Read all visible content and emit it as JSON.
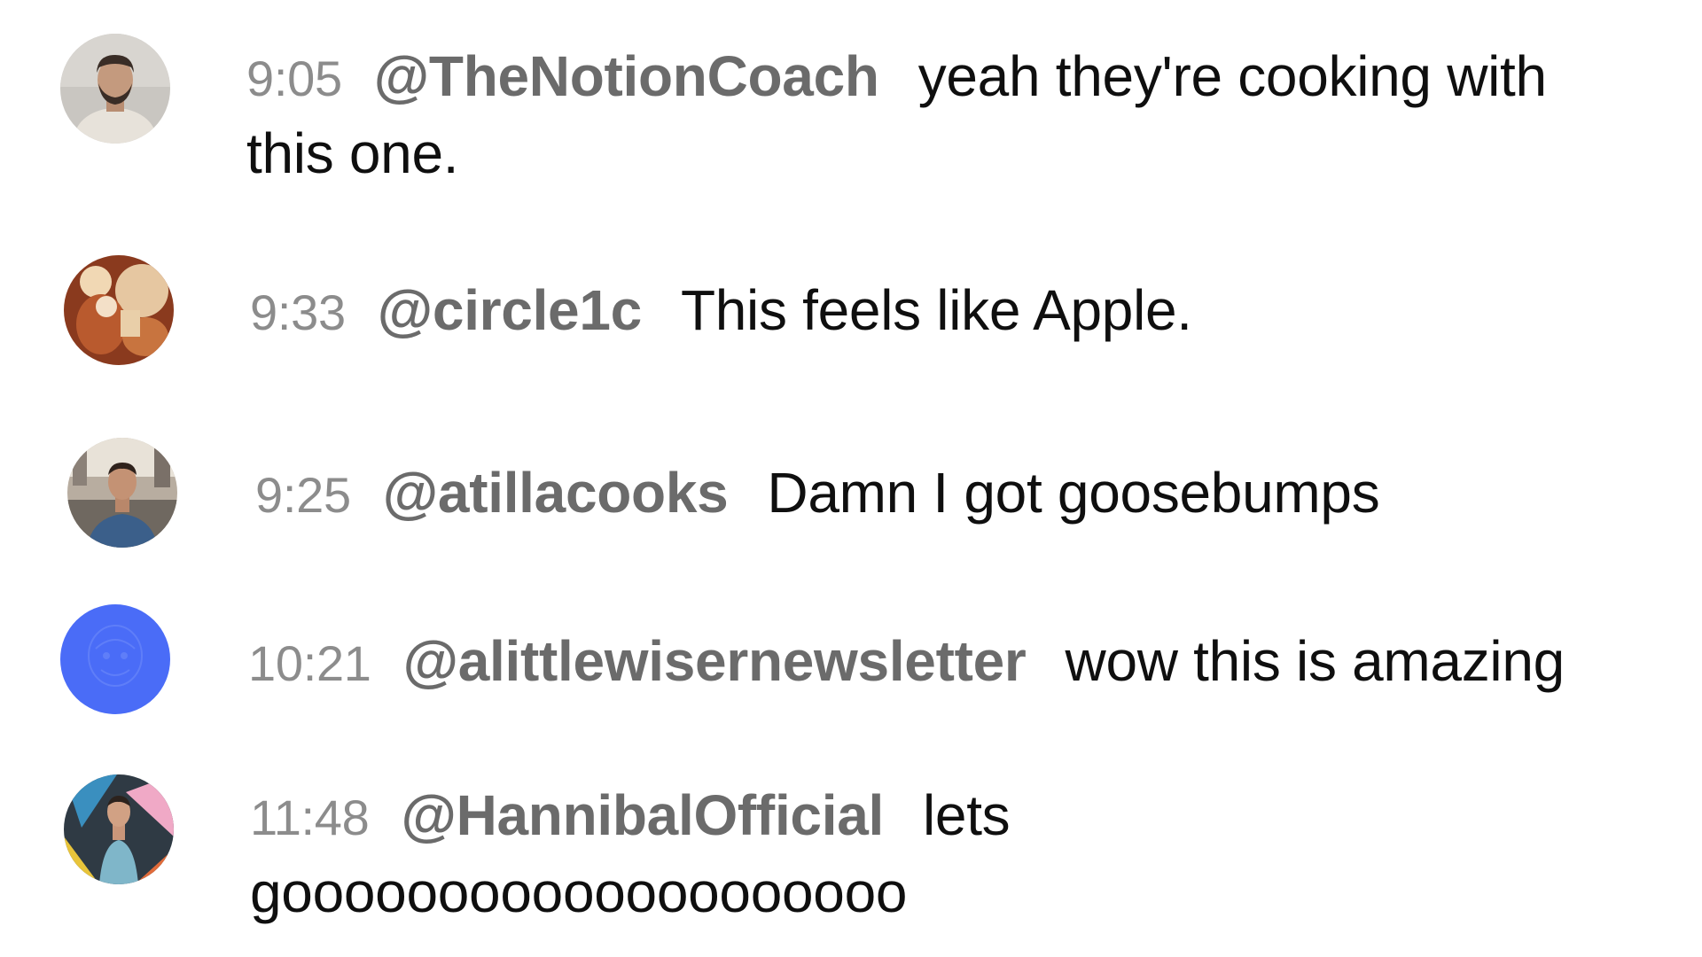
{
  "messages": [
    {
      "timestamp": "9:05",
      "author": "@TheNotionCoach",
      "text": "yeah they're cooking with this one.",
      "avatar": "avatar-man-beard"
    },
    {
      "timestamp": "9:33",
      "author": "@circle1c",
      "text": "This feels like Apple.",
      "avatar": "avatar-photo-warm"
    },
    {
      "timestamp": "9:25",
      "author": "@atillacooks",
      "text": "Damn I got goosebumps",
      "avatar": "avatar-man-street"
    },
    {
      "timestamp": "10:21",
      "author": "@alittlewisernewsletter",
      "text": "wow this is amazing",
      "avatar": "avatar-blue-sketch"
    },
    {
      "timestamp": "11:48",
      "author": "@HannibalOfficial",
      "text": "lets goooooooooooooooooooo",
      "avatar": "avatar-man-mural"
    }
  ],
  "colors": {
    "timestamp": "#8c8c8c",
    "author": "#6b6b6b",
    "text": "#0f0f0f",
    "blue_avatar": "#4a6cf7"
  }
}
